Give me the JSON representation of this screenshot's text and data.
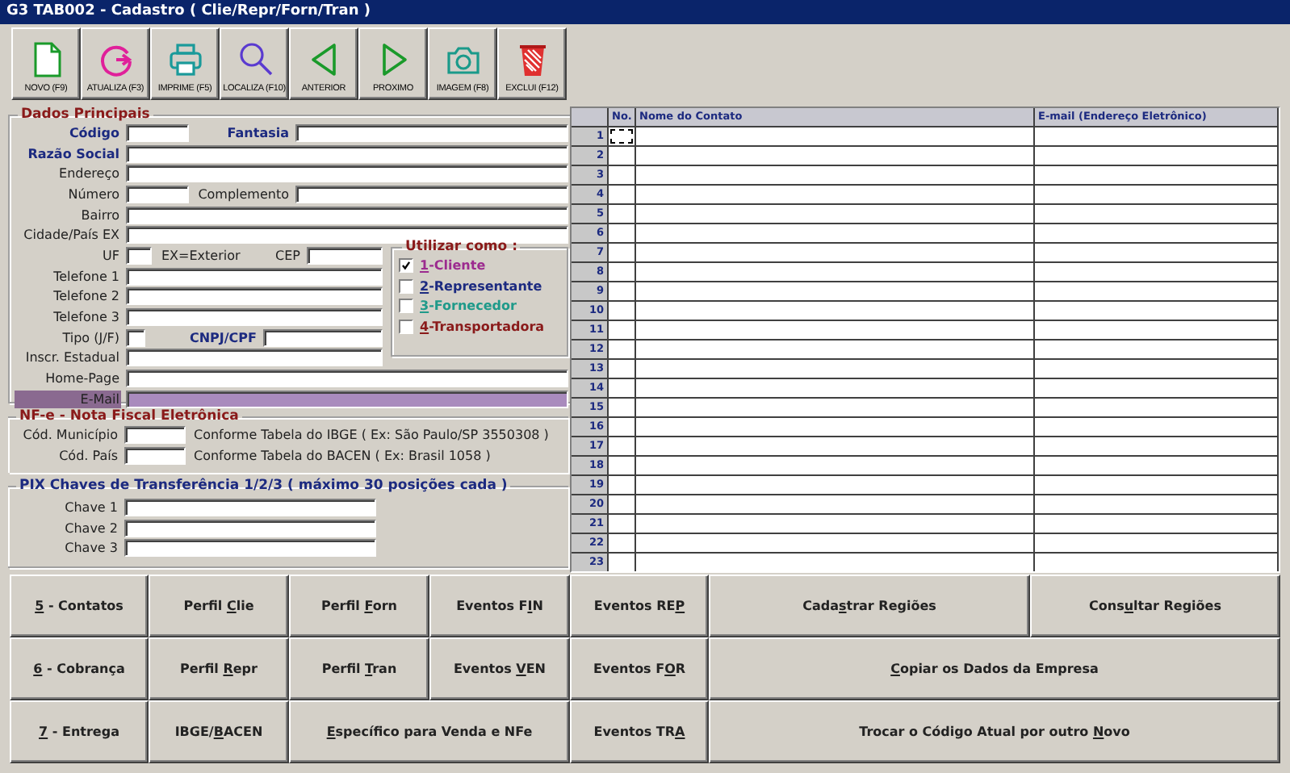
{
  "window": {
    "title": "G3 TAB002 - Cadastro ( Clie/Repr/Forn/Tran )"
  },
  "toolbar": [
    {
      "kind": "new",
      "label": "NOVO (F9)"
    },
    {
      "kind": "refresh",
      "label": "ATUALIZA (F3)"
    },
    {
      "kind": "print",
      "label": "IMPRIME (F5)"
    },
    {
      "kind": "search",
      "label": "LOCALIZA (F10)"
    },
    {
      "kind": "previous",
      "label": "ANTERIOR"
    },
    {
      "kind": "next",
      "label": "PROXIMO"
    },
    {
      "kind": "camera",
      "label": "IMAGEM (F8)"
    },
    {
      "kind": "delete",
      "label": "EXCLUI (F12)"
    }
  ],
  "dados_principais": {
    "title": "Dados Principais",
    "rows_top": [
      [
        {
          "label": "Código",
          "required": true,
          "focused": false
        },
        {
          "label": "Fantasia",
          "required": true,
          "focused": false
        }
      ],
      [
        {
          "label": "Razão Social",
          "required": true,
          "focused": false
        }
      ],
      [
        {
          "label": "Endereço",
          "required": false,
          "focused": false
        }
      ],
      [
        {
          "label": "Número",
          "required": false,
          "focused": false
        },
        {
          "label": "Complemento",
          "required": false,
          "focused": false
        }
      ],
      [
        {
          "label": "Bairro",
          "required": false,
          "focused": false
        }
      ],
      [
        {
          "label": "Cidade/País EX",
          "required": false,
          "focused": false
        }
      ]
    ],
    "rows_middle": [
      [
        {
          "label": "UF",
          "note": "EX=Exterior",
          "required": false,
          "focused": false
        },
        {
          "label": "CEP",
          "required": false,
          "focused": false
        }
      ],
      [
        {
          "label": "Telefone 1",
          "required": false,
          "focused": false
        }
      ],
      [
        {
          "label": "Telefone 2",
          "required": false,
          "focused": false
        }
      ],
      [
        {
          "label": "Telefone 3",
          "required": false,
          "focused": false
        }
      ],
      [
        {
          "label": "Tipo (J/F)",
          "required": false,
          "focused": false
        },
        {
          "label": "CNPJ/CPF",
          "required": true,
          "focused": false
        }
      ],
      [
        {
          "label": "Inscr. Estadual",
          "required": false,
          "focused": false
        }
      ]
    ],
    "utilizar_como": {
      "title": "Utilizar como :",
      "options": [
        {
          "key": "1",
          "label": "-Cliente",
          "color": "#9c2b8f",
          "checked": true
        },
        {
          "key": "2",
          "label": "-Representante",
          "color": "#1c2a80",
          "checked": false
        },
        {
          "key": "3",
          "label": "-Fornecedor",
          "color": "#1f9a8a",
          "checked": false
        },
        {
          "key": "4",
          "label": "-Transportadora",
          "color": "#8a1a1a",
          "checked": false
        }
      ]
    },
    "rows_bottom": [
      [
        {
          "label": "Home-Page",
          "required": false,
          "focused": false
        }
      ],
      [
        {
          "label": "E-Mail",
          "required": false,
          "focused": true
        }
      ]
    ]
  },
  "nfe": {
    "title": "NF-e - Nota Fiscal Eletrônica",
    "rows": [
      {
        "label": "Cód. Município",
        "hint": "Conforme Tabela do IBGE ( Ex: São Paulo/SP 3550308 )"
      },
      {
        "label": "Cód. País",
        "hint": "Conforme Tabela do BACEN ( Ex: Brasil 1058 )"
      }
    ]
  },
  "pix": {
    "title": "PIX Chaves de Transferência 1/2/3 ( máximo 30 posições cada )",
    "rows": [
      {
        "label": "Chave 1"
      },
      {
        "label": "Chave 2"
      },
      {
        "label": "Chave 3"
      }
    ]
  },
  "contacts": {
    "columns": [
      "No.",
      "Nome do Contato",
      "E-mail (Endereço Eletrônico)"
    ],
    "rows": [
      {
        "number": "1",
        "focused": true
      },
      {
        "number": "2",
        "focused": false
      },
      {
        "number": "3",
        "focused": false
      },
      {
        "number": "4",
        "focused": false
      },
      {
        "number": "5",
        "focused": false
      },
      {
        "number": "6",
        "focused": false
      },
      {
        "number": "7",
        "focused": false
      },
      {
        "number": "8",
        "focused": false
      },
      {
        "number": "9",
        "focused": false
      },
      {
        "number": "10",
        "focused": false
      },
      {
        "number": "11",
        "focused": false
      },
      {
        "number": "12",
        "focused": false
      },
      {
        "number": "13",
        "focused": false
      },
      {
        "number": "14",
        "focused": false
      },
      {
        "number": "15",
        "focused": false
      },
      {
        "number": "16",
        "focused": false
      },
      {
        "number": "17",
        "focused": false
      },
      {
        "number": "18",
        "focused": false
      },
      {
        "number": "19",
        "focused": false
      },
      {
        "number": "20",
        "focused": false
      },
      {
        "number": "21",
        "focused": false
      },
      {
        "number": "22",
        "focused": false
      },
      {
        "number": "23",
        "focused": false
      }
    ]
  },
  "actions": [
    [
      {
        "key": "5",
        "post": " - Contatos"
      },
      {
        "pre": "Perfil ",
        "key": "C",
        "post": "lie"
      },
      {
        "pre": "Perfil ",
        "key": "F",
        "post": "orn"
      },
      {
        "pre": "Eventos F",
        "key": "I",
        "post": "N"
      },
      {
        "pre": "Eventos RE",
        "key": "P"
      },
      {
        "pre": "Cada",
        "key": "s",
        "post": "trar Regiões"
      },
      {
        "pre": "Cons",
        "key": "u",
        "post": "ltar Regiões"
      }
    ],
    [
      {
        "key": "6",
        "post": " - Cobrança"
      },
      {
        "pre": "Perfil ",
        "key": "R",
        "post": "epr"
      },
      {
        "pre": "Perfil ",
        "key": "T",
        "post": "ran"
      },
      {
        "pre": "Eventos ",
        "key": "V",
        "post": "EN"
      },
      {
        "pre": "Eventos F",
        "key": "O",
        "post": "R"
      },
      {
        "key": "C",
        "post": "opiar os Dados da Empresa"
      }
    ],
    [
      {
        "key": "7",
        "post": " - Entrega"
      },
      {
        "pre": "IBGE/",
        "key": "B",
        "post": "ACEN"
      },
      {
        "key": "E",
        "post": "specífico para Venda e NFe"
      },
      {
        "pre": "Eventos TR",
        "key": "A"
      },
      {
        "pre": "Trocar o Código Atual por outro ",
        "key": "N",
        "post": "ovo"
      }
    ]
  ]
}
